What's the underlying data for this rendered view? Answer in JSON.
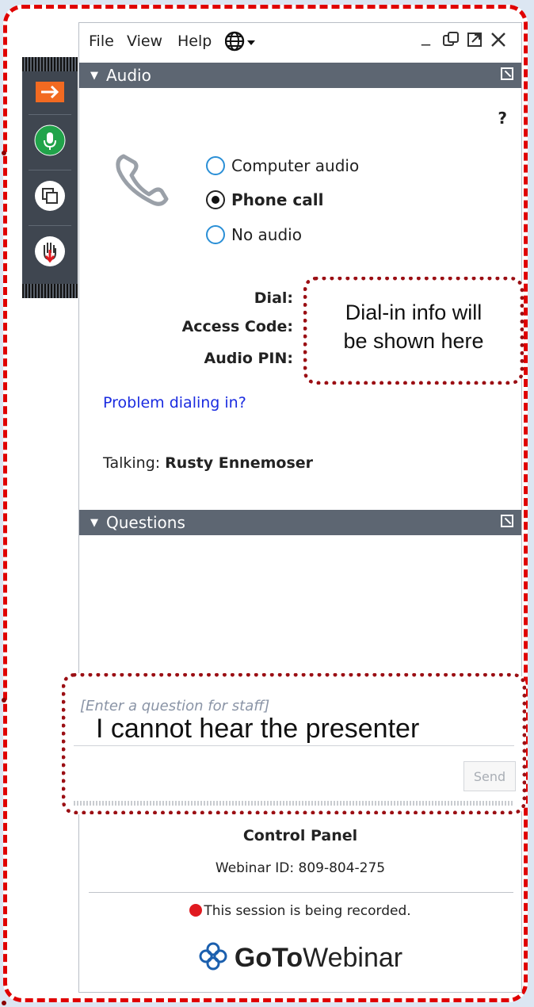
{
  "menu": {
    "file": "File",
    "view": "View",
    "help": "Help"
  },
  "window_controls": {
    "minimize": "_"
  },
  "audio": {
    "header": "Audio",
    "help": "?",
    "options": [
      {
        "label": "Computer audio",
        "selected": false
      },
      {
        "label": "Phone call",
        "selected": true
      },
      {
        "label": "No audio",
        "selected": false
      }
    ],
    "dial_label": "Dial:",
    "access_code_label": "Access Code:",
    "audio_pin_label": "Audio PIN:",
    "callout_line1": "Dial-in info will",
    "callout_line2": "be shown here",
    "problem_link": "Problem dialing in?",
    "talking_label": "Talking:",
    "talking_name": "Rusty Ennemoser"
  },
  "questions": {
    "header": "Questions",
    "placeholder": "[Enter a question for staff]",
    "typed_text": "I cannot hear the presenter",
    "send_label": "Send"
  },
  "footer": {
    "title": "Control Panel",
    "webinar_id": "Webinar ID: 809-804-275",
    "recording": "This session is being recorded.",
    "logo_bold": "GoTo",
    "logo_rest": "Webinar"
  },
  "colors": {
    "frame_border": "#e00000",
    "callout_border": "#9b0f14",
    "header_bg": "#5d6672",
    "link": "#1a2be0",
    "mic_green": "#21a34a",
    "arrow_orange": "#f26a21"
  },
  "icons": [
    "arrow-right-icon",
    "microphone-icon",
    "screen-share-icon",
    "raise-hand-icon",
    "phone-icon",
    "globe-icon",
    "restore-icon",
    "popout-icon",
    "close-icon",
    "recording-dot-icon",
    "gotowebinar-logo-icon"
  ]
}
